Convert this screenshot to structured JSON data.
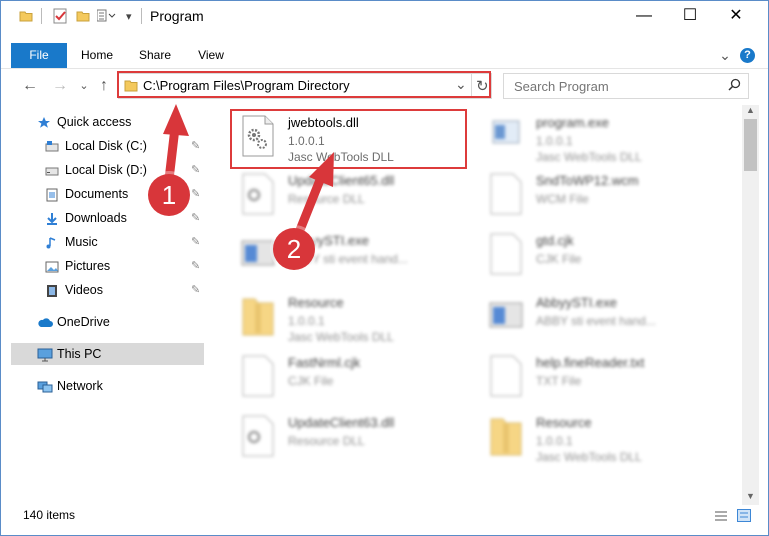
{
  "window": {
    "title": "Program",
    "controls": {
      "minimize": "—",
      "maximize": "☐",
      "close": "✕"
    }
  },
  "ribbon": {
    "tabs": [
      "File",
      "Home",
      "Share",
      "View"
    ],
    "expand": "⌄",
    "help": "?"
  },
  "nav": {
    "back": "←",
    "forward": "→",
    "dropdown": "⌄",
    "up": "↑"
  },
  "address": {
    "path": "C:\\Program Files\\Program Directory",
    "dropdown": "⌄",
    "refresh": "↻"
  },
  "search": {
    "placeholder": "Search Program",
    "icon": "search-icon"
  },
  "sidebar": {
    "items": [
      {
        "label": "Quick access",
        "icon": "star-icon",
        "pinned": false
      },
      {
        "label": "Local Disk (C:)",
        "icon": "drive-icon",
        "pinned": true
      },
      {
        "label": "Local Disk (D:)",
        "icon": "drive-icon",
        "pinned": true
      },
      {
        "label": "Documents",
        "icon": "documents-icon",
        "pinned": true
      },
      {
        "label": "Downloads",
        "icon": "download-icon",
        "pinned": true
      },
      {
        "label": "Music",
        "icon": "music-icon",
        "pinned": true
      },
      {
        "label": "Pictures",
        "icon": "pictures-icon",
        "pinned": true
      },
      {
        "label": "Videos",
        "icon": "videos-icon",
        "pinned": true
      },
      {
        "label": "OneDrive",
        "icon": "cloud-icon",
        "pinned": false
      },
      {
        "label": "This PC",
        "icon": "computer-icon",
        "pinned": false,
        "selected": true
      },
      {
        "label": "Network",
        "icon": "network-icon",
        "pinned": false
      }
    ],
    "pin_glyph": "📌"
  },
  "files": [
    {
      "name": "jwebtools.dll",
      "line2": "1.0.0.1",
      "line3": "Jasc WebTools DLL",
      "icon": "dll-gear-icon",
      "blurred": false
    },
    {
      "name": "program.exe",
      "line2": "1.0.0.1",
      "line3": "Jasc WebTools DLL",
      "icon": "exe-icon",
      "blurred": true
    },
    {
      "name": "UpdateClient65.dll",
      "line2": "Resource DLL",
      "line3": "",
      "icon": "dll-gear-icon",
      "blurred": true
    },
    {
      "name": "SndToWP12.wcm",
      "line2": "WCM File",
      "line3": "",
      "icon": "blank-file-icon",
      "blurred": true
    },
    {
      "name": "AbbyySTI.exe",
      "line2": "ABBY sti event hand...",
      "line3": "",
      "icon": "exe-window-icon",
      "blurred": true
    },
    {
      "name": "gtd.cjk",
      "line2": "CJK File",
      "line3": "",
      "icon": "blank-file-icon",
      "blurred": true
    },
    {
      "name": "Resource",
      "line2": "1.0.0.1",
      "line3": "Jasc WebTools DLL",
      "icon": "archive-icon",
      "blurred": true
    },
    {
      "name": "AbbyySTI.exe",
      "line2": "ABBY sti event hand...",
      "line3": "",
      "icon": "exe-window-icon",
      "blurred": true
    },
    {
      "name": "FastNrml.cjk",
      "line2": "CJK File",
      "line3": "",
      "icon": "blank-file-icon",
      "blurred": true
    },
    {
      "name": "help.fineReader.txt",
      "line2": "TXT File",
      "line3": "",
      "icon": "blank-file-icon",
      "blurred": true
    },
    {
      "name": "UpdateClient63.dll",
      "line2": "Resource DLL",
      "line3": "",
      "icon": "dll-gear-icon",
      "blurred": true
    },
    {
      "name": "Resource",
      "line2": "1.0.0.1",
      "line3": "Jasc WebTools DLL",
      "icon": "archive-icon",
      "blurred": true
    }
  ],
  "status": {
    "count": "140 items"
  },
  "annotations": [
    {
      "label": "1",
      "color": "#d8363a"
    },
    {
      "label": "2",
      "color": "#d8363a"
    }
  ]
}
